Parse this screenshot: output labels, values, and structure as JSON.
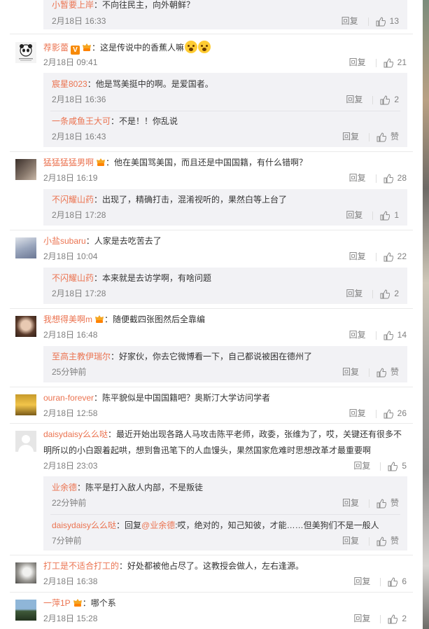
{
  "ui": {
    "reply_label": "回复",
    "like_zero": "赞"
  },
  "comments": [
    {
      "user": "",
      "text": "",
      "time": "2月18日 16:33",
      "likes": "13",
      "replies": [
        {
          "user": "小暂要上岸",
          "text": "：不向往民主，向外朝鲜？"
        }
      ]
    },
    {
      "user": "荐影蕾",
      "text": "：这是传说中的香蕉人嘛",
      "time": "2月18日 09:41",
      "likes": "21",
      "replies": [
        {
          "user": "宸星8023",
          "text": "：他是骂美挺中的啊。是爱国者。",
          "time": "2月18日 16:36",
          "likes": "2"
        },
        {
          "user": "一条咸鱼王大可",
          "text": "：不是！！你乱说",
          "time": "2月18日 16:43",
          "likes": "赞"
        }
      ]
    },
    {
      "user": "猛猛猛猛男啊",
      "text": "：他在美国骂美国，而且还是中国国籍，有什么错啊？",
      "time": "2月18日 16:19",
      "likes": "28",
      "replies": [
        {
          "user": "不闪耀山药",
          "text": "：出现了，精确打击，混淆视听的，果然白等上台了",
          "time": "2月18日 17:28",
          "likes": "1"
        }
      ]
    },
    {
      "user": "小盐subaru",
      "text": "：人家是去吃苦去了",
      "time": "2月18日 10:04",
      "likes": "22",
      "replies": [
        {
          "user": "不闪耀山药",
          "text": "：本来就是去访学啊，有啥问题",
          "time": "2月18日 17:28",
          "likes": "2"
        }
      ]
    },
    {
      "user": "我想得美啊m",
      "text": "：随便截四张图然后全靠编",
      "time": "2月18日 16:48",
      "likes": "14",
      "replies": [
        {
          "user": "至高主教伊瑞尔",
          "text": "：好家伙，你去它微博看一下，自己都说被困在德州了",
          "time": "25分钟前",
          "likes": "赞"
        }
      ]
    },
    {
      "user": "ouran-forever",
      "text": "：陈平貌似是中国国籍吧？奥斯汀大学访问学者",
      "time": "2月18日 12:58",
      "likes": "26"
    },
    {
      "user": "daisydaisy么么哒",
      "text": "：最近开始出现各路人马攻击陈平老师，政委，张维为了，哎，关键还有很多不",
      "text2": "明所以的小白跟着起哄，想到鲁迅笔下的人血馒头，果然国家危难时思想改革才最重要啊",
      "time": "2月18日 23:03",
      "likes": "5",
      "replies": [
        {
          "user": "业余德",
          "text": "：陈平是打入敌人内部，不是叛徒",
          "time": "22分钟前",
          "likes": "赞"
        },
        {
          "user": "daisydaisy么么哒",
          "text": "：回复",
          "mention": "@业余德",
          "text_b": ":哎，绝对的，知己知彼，才能……但美狗们不是一般人",
          "time": "7分钟前",
          "likes": "赞"
        }
      ]
    },
    {
      "user": "打工是不适合打工的",
      "text": "：好处都被他占尽了。这教授会做人，左右逢源。",
      "time": "2月18日 16:38",
      "likes": "6"
    },
    {
      "user": "一萍1P",
      "text": "：哪个系",
      "time": "2月18日 15:28",
      "likes": "2"
    }
  ]
}
